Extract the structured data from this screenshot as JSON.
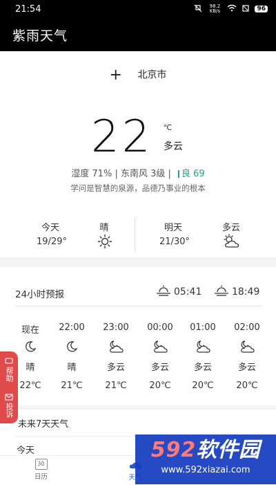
{
  "status": {
    "time": "21:54",
    "speed": "98.2 KB/s",
    "battery": "96"
  },
  "app": {
    "title": "紫雨天气"
  },
  "main": {
    "city": "北京市",
    "temp": "22",
    "unit": "℃",
    "condition": "多云",
    "meta": "湿度 71% | 东南风 3级 |",
    "aqi": "良 69",
    "quote": "学问是智慧的泉源，品德乃事业的根本"
  },
  "days": [
    {
      "label": "今天",
      "cond": "晴",
      "range": "19/29°",
      "icon": "sun-icon"
    },
    {
      "label": "明天",
      "cond": "多云",
      "range": "21/30°",
      "icon": "cloud-sun-icon"
    }
  ],
  "forecast": {
    "title": "24小时预报",
    "sunrise": "05:41",
    "sunset": "18:49",
    "hours": [
      {
        "time": "现在",
        "desc": "晴",
        "temp": "22℃",
        "icon": "moon-icon"
      },
      {
        "time": "22:00",
        "desc": "晴",
        "temp": "21℃",
        "icon": "moon-icon"
      },
      {
        "time": "23:00",
        "desc": "多云",
        "temp": "21℃",
        "icon": "cloud-moon-icon"
      },
      {
        "time": "00:00",
        "desc": "多云",
        "temp": "20℃",
        "icon": "cloud-moon-icon"
      },
      {
        "time": "01:00",
        "desc": "多云",
        "temp": "20℃",
        "icon": "cloud-moon-icon"
      },
      {
        "time": "02:00",
        "desc": "多云",
        "temp": "20℃",
        "icon": "cloud-moon-icon"
      }
    ]
  },
  "week": {
    "title": "未来7天天气",
    "today": "今天"
  },
  "help": {
    "help": "帮助",
    "complain": "投诉"
  },
  "nav": {
    "calendar": "日历",
    "calendar_num": "30",
    "weather": "天气"
  },
  "watermark": {
    "num": "592",
    "name": "软件园",
    "url": "www.592xiazai.com"
  },
  "colors": {
    "accent": "#21a187",
    "help": "#e14a4a",
    "watermark": "#143cbe"
  }
}
